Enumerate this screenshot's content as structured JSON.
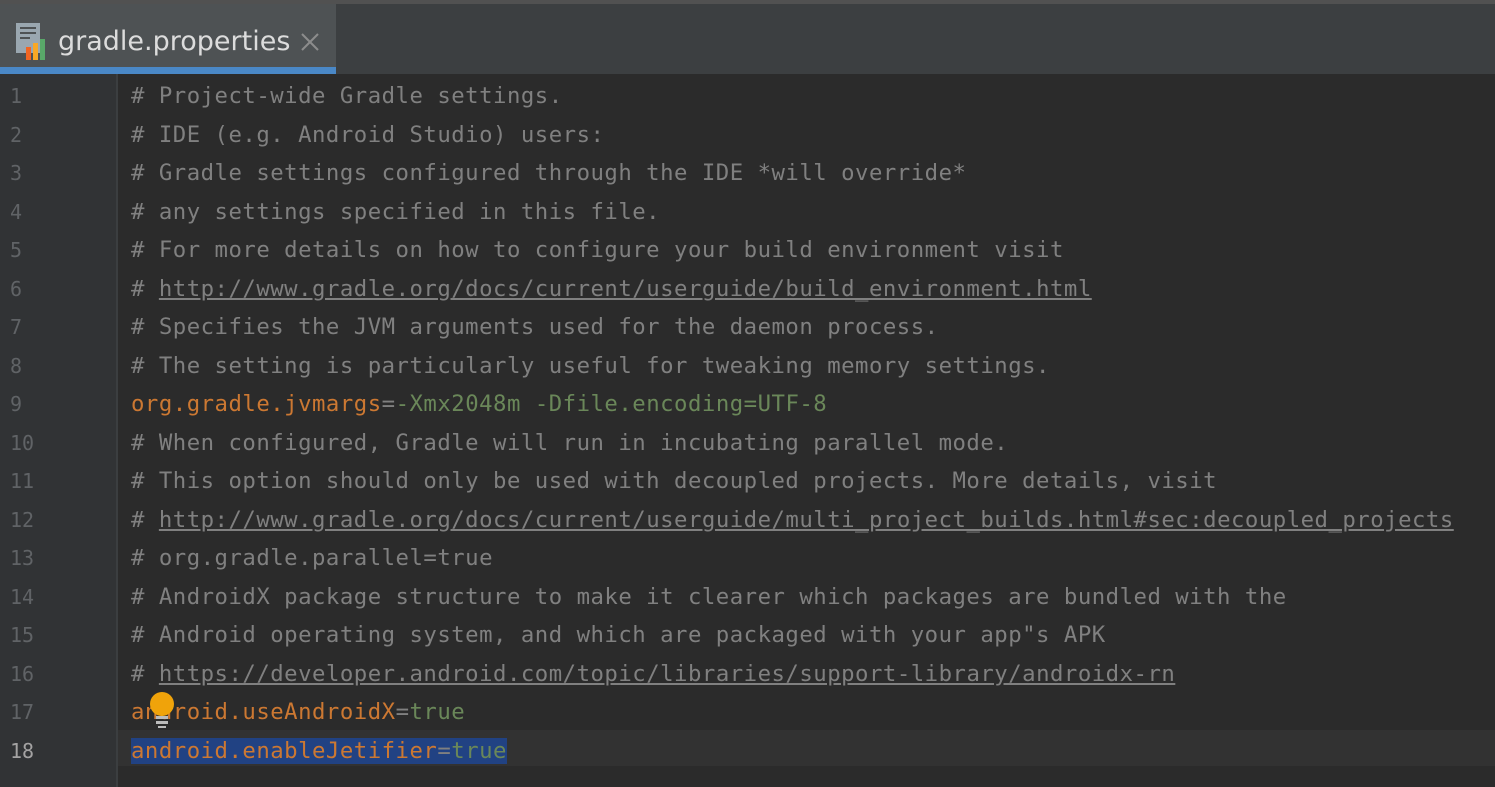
{
  "tab": {
    "title": "gradle.properties",
    "icon": "gradle-properties-icon",
    "close_glyph": "✕"
  },
  "colors": {
    "accent": "#4a88c7",
    "keyword": "#cc7832",
    "value": "#6a8759",
    "comment": "#808080",
    "selection": "#214283"
  },
  "lines": [
    {
      "num": "1",
      "comment": "# Project-wide Gradle settings."
    },
    {
      "num": "2",
      "comment": "# IDE (e.g. Android Studio) users:"
    },
    {
      "num": "3",
      "comment": "# Gradle settings configured through the IDE *will override*"
    },
    {
      "num": "4",
      "comment": "# any settings specified in this file."
    },
    {
      "num": "5",
      "comment": "# For more details on how to configure your build environment visit"
    },
    {
      "num": "6",
      "prefix": "# ",
      "link": "http://www.gradle.org/docs/current/userguide/build_environment.html"
    },
    {
      "num": "7",
      "comment": "# Specifies the JVM arguments used for the daemon process."
    },
    {
      "num": "8",
      "comment": "# The setting is particularly useful for tweaking memory settings."
    },
    {
      "num": "9",
      "key": "org.gradle.jvmargs",
      "eq": "=",
      "value": "-Xmx2048m -Dfile.encoding=UTF-8"
    },
    {
      "num": "10",
      "comment": "# When configured, Gradle will run in incubating parallel mode."
    },
    {
      "num": "11",
      "comment": "# This option should only be used with decoupled projects. More details, visit"
    },
    {
      "num": "12",
      "prefix": "# ",
      "link": "http://www.gradle.org/docs/current/userguide/multi_project_builds.html#sec:decoupled_projects"
    },
    {
      "num": "13",
      "comment": "# org.gradle.parallel=true"
    },
    {
      "num": "14",
      "comment": "# AndroidX package structure to make it clearer which packages are bundled with the"
    },
    {
      "num": "15",
      "comment": "# Android operating system, and which are packaged with your app\"s APK"
    },
    {
      "num": "16",
      "prefix": "# ",
      "link": "https://developer.android.com/topic/libraries/support-library/androidx-rn"
    },
    {
      "num": "17",
      "key": "android.useAndroidX",
      "eq": "=",
      "value": "true"
    },
    {
      "num": "18",
      "key": "android.enableJetifier",
      "eq": "=",
      "value": "true"
    }
  ]
}
